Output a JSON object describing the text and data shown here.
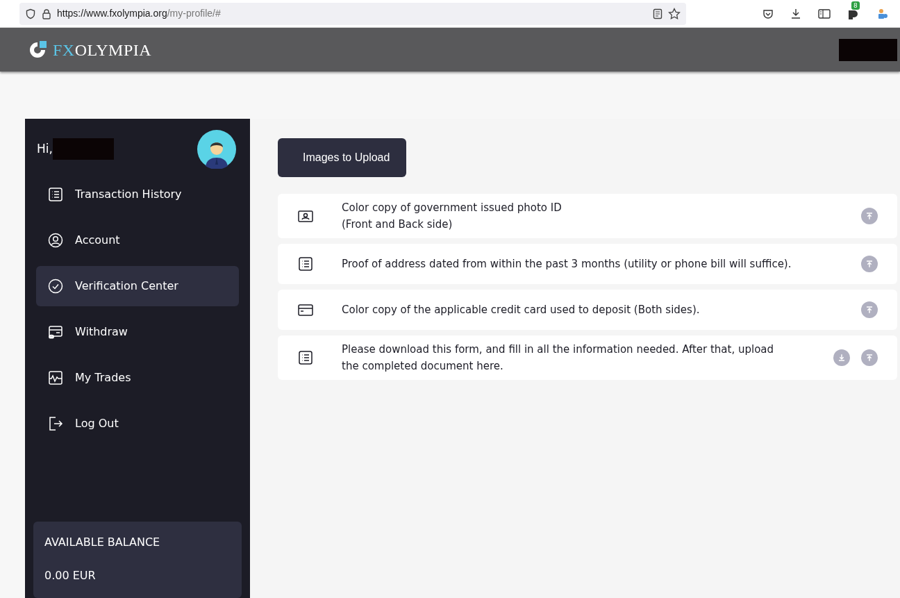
{
  "browser": {
    "url_host": "https://www.fxolympia.org",
    "url_path": "/my-profile/#",
    "extension_badge": "8"
  },
  "header": {
    "logo_accent": "FX",
    "logo_rest": "OLYMPIA"
  },
  "sidebar": {
    "greeting": "Hi,",
    "items": [
      {
        "kind": "list",
        "label": "Transaction History",
        "selected": false
      },
      {
        "kind": "user",
        "label": "Account",
        "selected": false
      },
      {
        "kind": "check",
        "label": "Verification Center",
        "selected": true
      },
      {
        "kind": "wallet",
        "label": "Withdraw",
        "selected": false
      },
      {
        "kind": "chart",
        "label": "My Trades",
        "selected": false
      },
      {
        "kind": "logout",
        "label": "Log Out",
        "selected": false
      }
    ],
    "balance": {
      "label": "AVAILABLE BALANCE",
      "value": "0.00 EUR"
    }
  },
  "main": {
    "upload_button": "Images to Upload",
    "documents": [
      {
        "kind": "id",
        "lines": [
          "Color copy of government issued photo ID",
          "(Front and Back side)"
        ],
        "download": false,
        "upload": true
      },
      {
        "kind": "list",
        "lines": [
          "Proof of address dated from within the past 3 months (utility or phone bill will suffice)."
        ],
        "download": false,
        "upload": true
      },
      {
        "kind": "card",
        "lines": [
          "Color copy of the applicable credit card used to deposit (Both sides)."
        ],
        "download": false,
        "upload": true
      },
      {
        "kind": "list",
        "lines": [
          "Please download this form, and fill in all the information needed. After that, upload",
          "the completed document here."
        ],
        "download": true,
        "upload": true
      }
    ]
  }
}
